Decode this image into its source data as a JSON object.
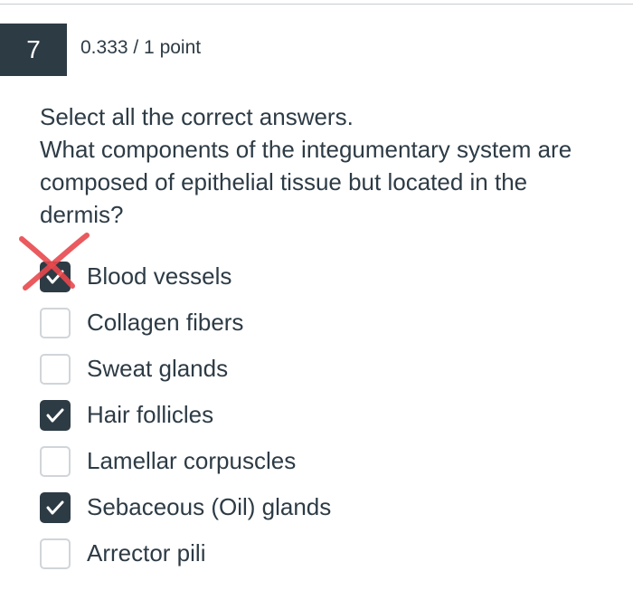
{
  "question": {
    "number": "7",
    "score": "0.333 / 1 point",
    "instruction": "Select all the correct answers.",
    "prompt": "What components of the integumentary system are composed of epithelial tissue but located in the dermis?"
  },
  "answers": [
    {
      "label": "Blood vessels",
      "checked": true,
      "marked_wrong": true
    },
    {
      "label": "Collagen fibers",
      "checked": false
    },
    {
      "label": "Sweat glands",
      "checked": false
    },
    {
      "label": "Hair follicles",
      "checked": true
    },
    {
      "label": "Lamellar corpuscles",
      "checked": false
    },
    {
      "label": "Sebaceous (Oil) glands",
      "checked": true
    },
    {
      "label": "Arrector pili",
      "checked": false
    }
  ],
  "colors": {
    "header_bg": "#2d3b45",
    "text": "#2d3b45",
    "checkbox_border": "#d0d5d9",
    "wrong_mark": "#e8484d"
  }
}
